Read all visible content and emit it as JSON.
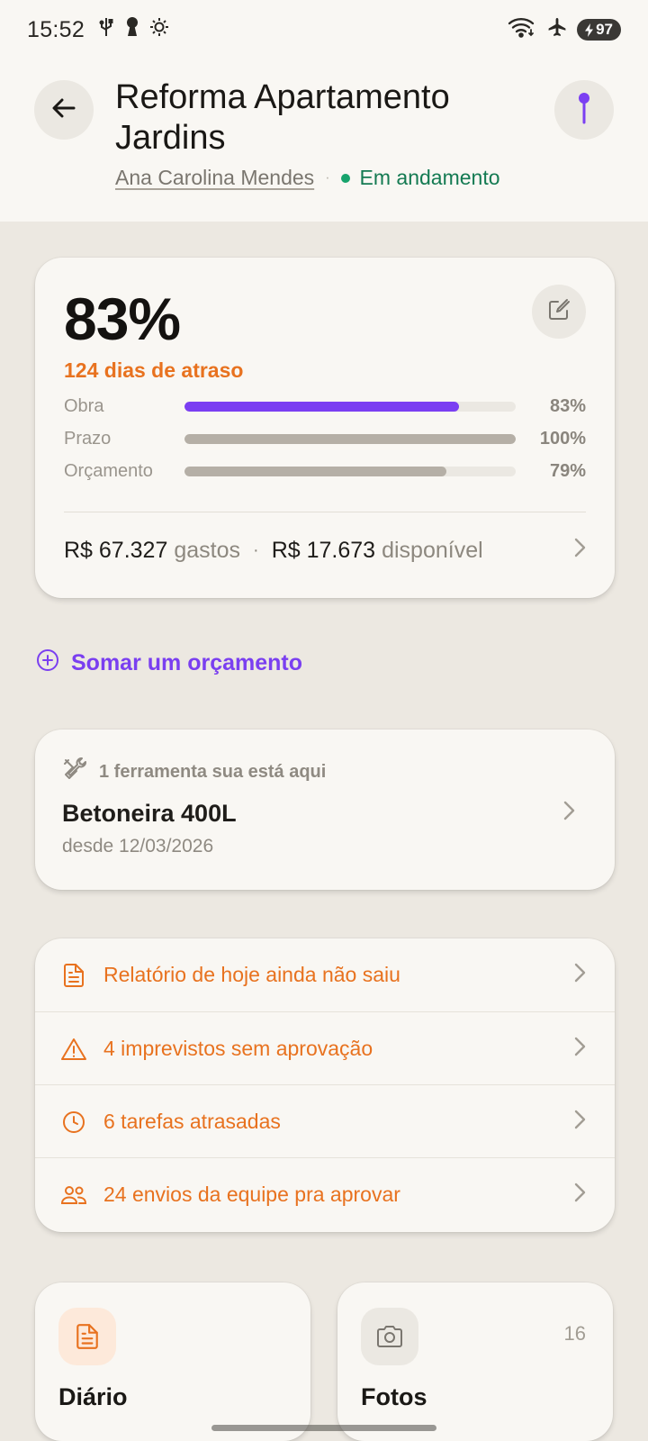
{
  "status_bar": {
    "time": "15:52",
    "battery": "97",
    "icons_left": [
      "usb-icon",
      "keyhole-icon",
      "brightness-icon"
    ],
    "icons_right": [
      "wifi-icon",
      "airplane-icon",
      "battery-icon"
    ]
  },
  "header": {
    "title": "Reforma Apartamento Jardins",
    "owner": "Ana Carolina Mendes",
    "separator": "·",
    "status": "Em andamento",
    "status_color": "#17a36c"
  },
  "progress": {
    "percent": "83%",
    "delay": "124 dias de atraso",
    "bars": [
      {
        "label": "Obra",
        "value": "83%",
        "fraction": 0.83,
        "color": "#7b3ff2"
      },
      {
        "label": "Prazo",
        "value": "100%",
        "fraction": 1.0,
        "color": "#b5afa6"
      },
      {
        "label": "Orçamento",
        "value": "79%",
        "fraction": 0.79,
        "color": "#b5afa6"
      }
    ],
    "spent_value": "R$ 67.327",
    "spent_label": "gastos",
    "sep": "·",
    "available_value": "R$ 17.673",
    "available_label": "disponível"
  },
  "add_budget": {
    "label": "Somar um orçamento",
    "color": "#7a3ff0"
  },
  "tool": {
    "heading": "1 ferramenta sua está aqui",
    "name": "Betoneira 400L",
    "since": "desde 12/03/2026"
  },
  "alerts": [
    {
      "text": "Relatório de hoje ainda não saiu",
      "icon": "document-icon"
    },
    {
      "text": "4 imprevistos sem aprovação",
      "icon": "warning-icon"
    },
    {
      "text": "6 tarefas atrasadas",
      "icon": "clock-icon"
    },
    {
      "text": "24 envios da equipe pra aprovar",
      "icon": "team-icon"
    }
  ],
  "accent_orange": "#e8721f",
  "tiles": {
    "diario": {
      "label": "Diário",
      "icon": "document-icon"
    },
    "fotos": {
      "label": "Fotos",
      "icon": "camera-icon",
      "count": "16"
    }
  }
}
